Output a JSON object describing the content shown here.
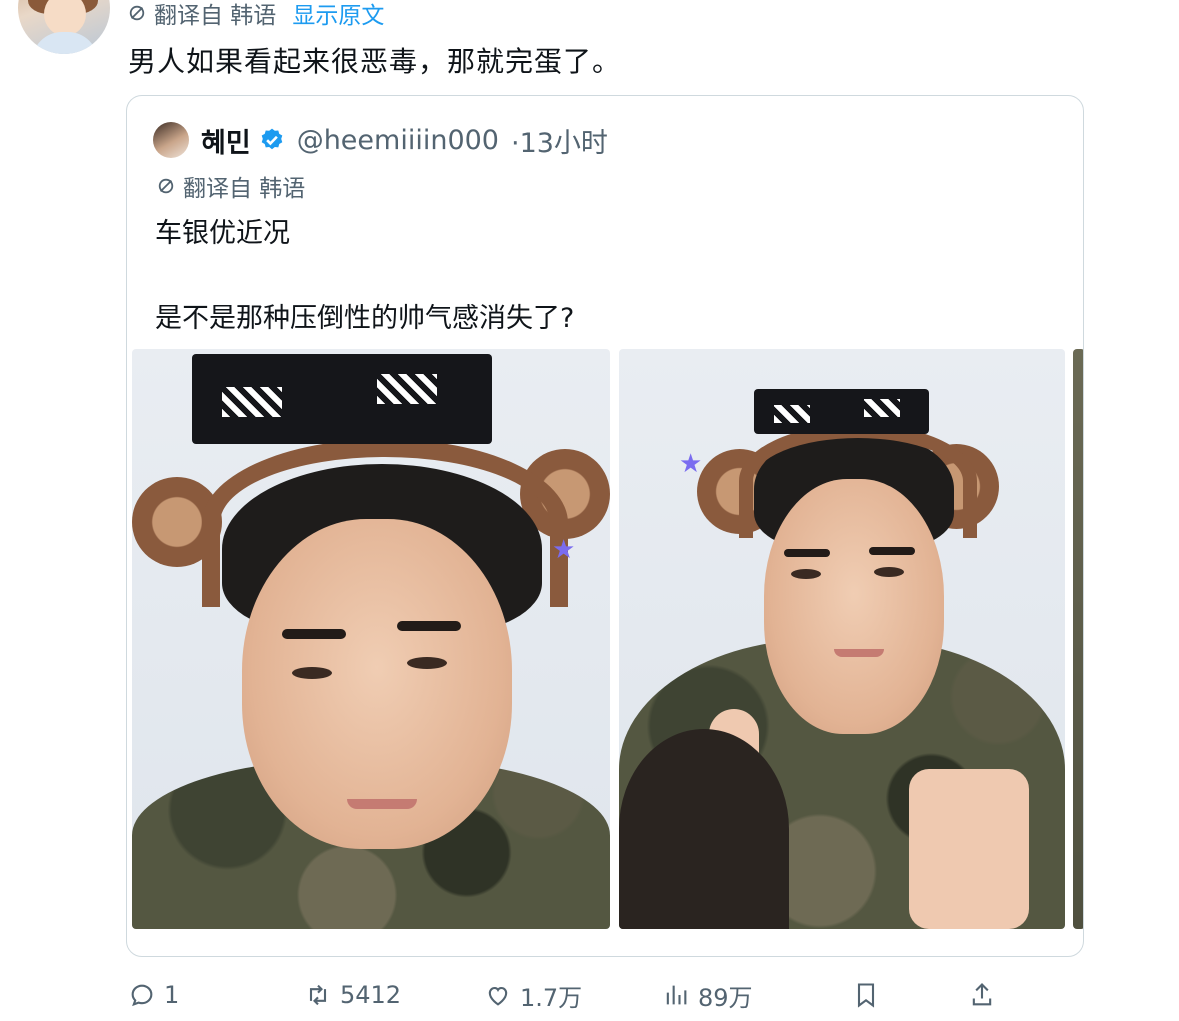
{
  "tweet": {
    "translate_label": "翻译自 韩语",
    "show_original": "显示原文",
    "text": "男人如果看起来很恶毒，那就完蛋了。"
  },
  "quoted": {
    "name": "혜민",
    "handle": "@heemiiiin000",
    "time": "·13小时",
    "translate_label": "翻译自 韩语",
    "line1": "车银优近况",
    "line2": "是不是那种压倒性的帅气感消失了?"
  },
  "actions": {
    "reply_count": "1",
    "retweet_count": "5412",
    "like_count": "1.7万",
    "view_count": "89万"
  },
  "colors": {
    "link": "#1d9bf0",
    "muted": "#536471",
    "border": "#cfd9de"
  },
  "icons": [
    "translate-icon",
    "verified-icon",
    "reply-icon",
    "retweet-icon",
    "like-icon",
    "views-icon",
    "bookmark-icon",
    "share-icon"
  ]
}
